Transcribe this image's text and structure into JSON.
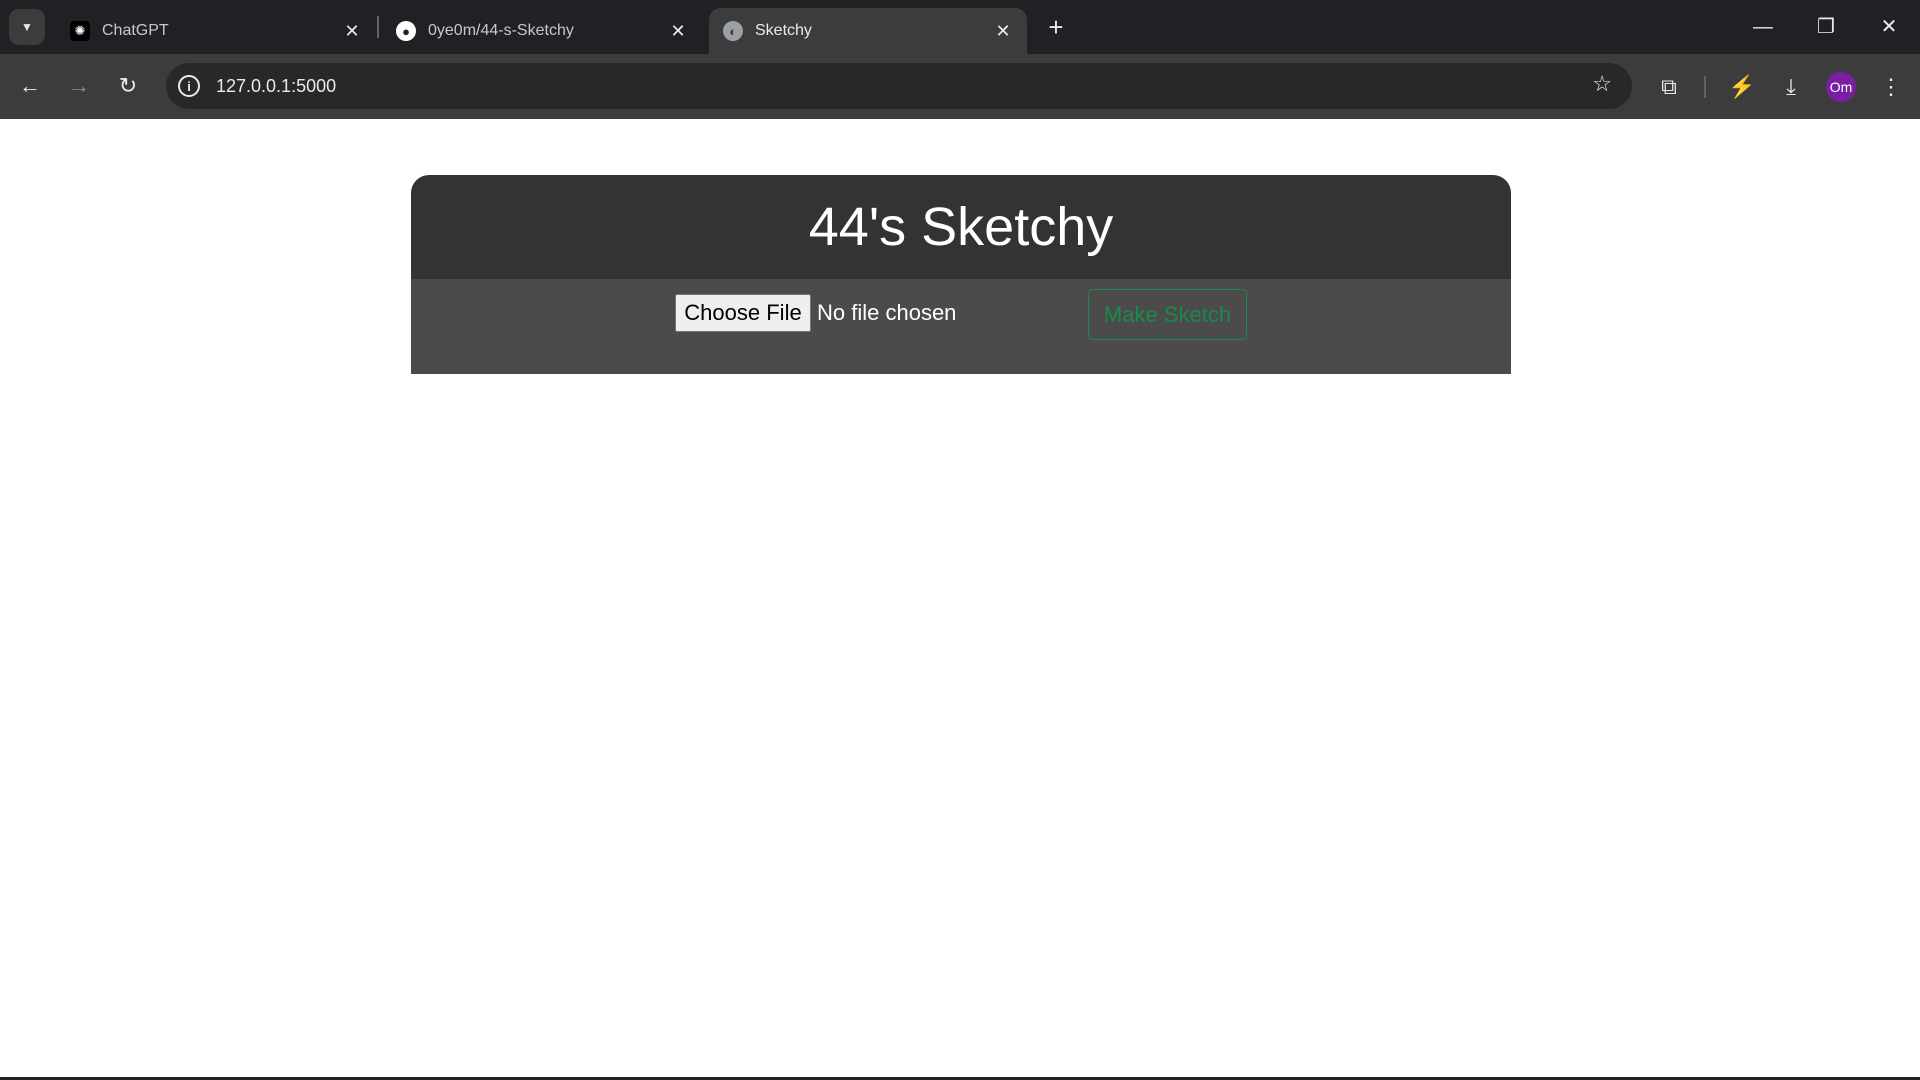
{
  "browser": {
    "tabs": [
      {
        "title": "ChatGPT",
        "icon": "chatgpt-icon"
      },
      {
        "title": "0ye0m/44-s-Sketchy",
        "icon": "github-icon"
      },
      {
        "title": "Sketchy",
        "icon": "globe-icon",
        "active": true
      }
    ],
    "url": "127.0.0.1:5000",
    "profile_initials": "Om",
    "profile_color": "#7b1fa2"
  },
  "page": {
    "title": "44's Sketchy",
    "choose_file_label": "Choose File",
    "file_status": "No file chosen",
    "make_sketch_label": "Make Sketch",
    "accent_color": "#1a8a4a"
  }
}
